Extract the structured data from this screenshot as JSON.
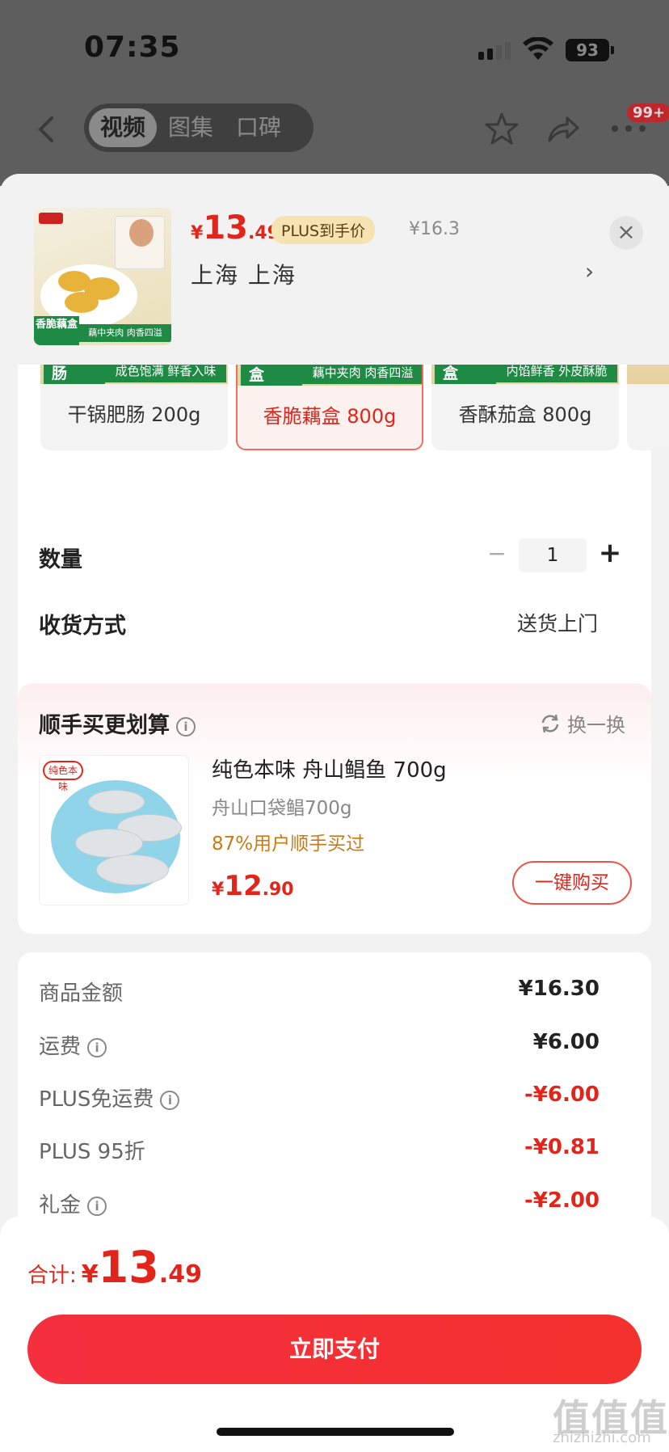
{
  "status_bar": {
    "time": "07:35",
    "battery": "93"
  },
  "nav": {
    "tabs": [
      {
        "label": "视频"
      },
      {
        "label": "图集"
      },
      {
        "label": "口碑"
      }
    ],
    "badge": "99+"
  },
  "product": {
    "price_currency": "¥",
    "price_int": "13",
    "price_dec": ".49",
    "plus_tag": "PLUS到手价",
    "original_price": "¥16.3",
    "address": "上海  上海",
    "address_arrow": "›",
    "close": "×",
    "thumb_tag": "香脆藕盒",
    "thumb_strip": "藕中夹肉 肉香四溢"
  },
  "variants": [
    {
      "tag": "干锅肥肠",
      "strip": "成色饱满 鲜香入味",
      "label": "干锅肥肠 200g",
      "selected": false
    },
    {
      "tag": "香脆藕盒",
      "strip": "藕中夹肉 肉香四溢",
      "label": "香脆藕盒 800g",
      "selected": true
    },
    {
      "tag": "香酥茄盒",
      "strip": "内馅鲜香 外皮酥脆",
      "label": "香酥茄盒 800g",
      "selected": false
    }
  ],
  "quantity": {
    "label": "数量",
    "minus": "−",
    "value": "1",
    "plus": "+"
  },
  "shipping": {
    "label": "收货方式",
    "value": "送货上门"
  },
  "upsell": {
    "title": "顺手买更划算",
    "swap": "换一换",
    "name": "纯色本味 舟山鲳鱼 700g",
    "sub": "舟山口袋鲳700g",
    "rate": "87%用户顺手买过",
    "price_currency": "¥",
    "price_int": "12",
    "price_dec": ".90",
    "buy_label": "一键购买",
    "logo_text": "纯色本味"
  },
  "fees": [
    {
      "label": "商品金额",
      "value": "¥16.30",
      "info": false,
      "red": false
    },
    {
      "label": "运费",
      "value": "¥6.00",
      "info": true,
      "red": false
    },
    {
      "label": "PLUS免运费",
      "value": "-¥6.00",
      "info": true,
      "red": true
    },
    {
      "label": "PLUS 95折",
      "value": "-¥0.81",
      "info": false,
      "red": true
    },
    {
      "label": "礼金",
      "value": "-¥2.00",
      "info": true,
      "red": true
    }
  ],
  "footer": {
    "total_label": "合计:",
    "total_currency": "¥",
    "total_int": "13",
    "total_dec": ".49",
    "pay_label": "立即支付"
  },
  "watermark": {
    "main": "值值值",
    "sub": "zhizhizhi.com"
  },
  "colors": {
    "accent_red": "#e1251b",
    "green_tag": "#1e8a44",
    "plus_gold": "#f6e3b2"
  }
}
